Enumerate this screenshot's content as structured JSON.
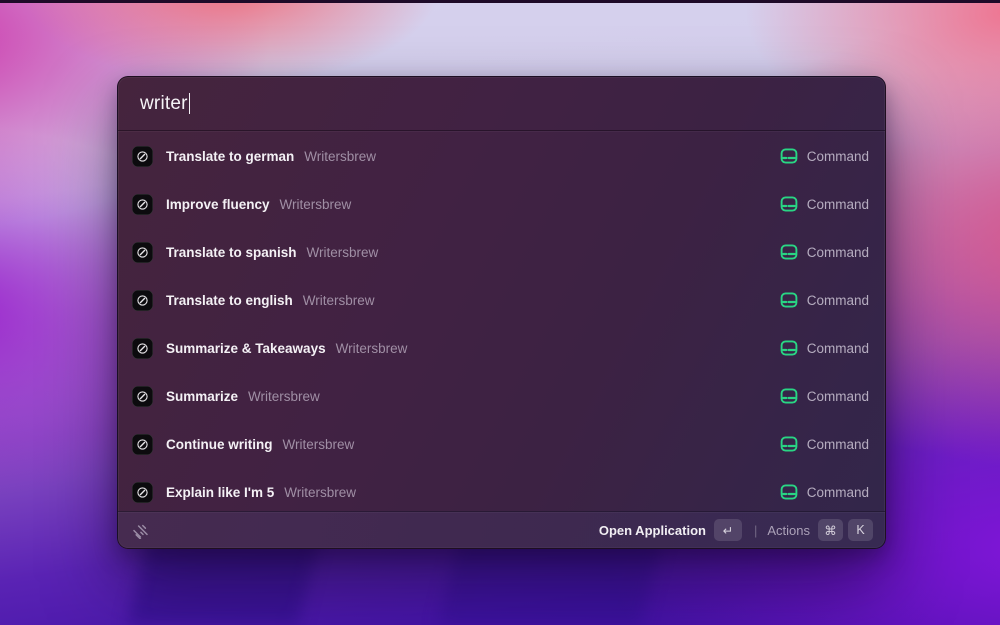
{
  "search": {
    "query": "writer"
  },
  "results": [
    {
      "title": "Translate to german",
      "app": "Writersbrew",
      "accessory": "Command"
    },
    {
      "title": "Improve fluency",
      "app": "Writersbrew",
      "accessory": "Command"
    },
    {
      "title": "Translate to spanish",
      "app": "Writersbrew",
      "accessory": "Command"
    },
    {
      "title": "Translate to english",
      "app": "Writersbrew",
      "accessory": "Command"
    },
    {
      "title": "Summarize & Takeaways",
      "app": "Writersbrew",
      "accessory": "Command"
    },
    {
      "title": "Summarize",
      "app": "Writersbrew",
      "accessory": "Command"
    },
    {
      "title": "Continue writing",
      "app": "Writersbrew",
      "accessory": "Command"
    },
    {
      "title": "Explain like I'm 5",
      "app": "Writersbrew",
      "accessory": "Command"
    }
  ],
  "footer": {
    "open_label": "Open Application",
    "return_key": "↵",
    "divider": "|",
    "actions_label": "Actions",
    "cmd_key": "⌘",
    "k_key": "K"
  },
  "icons": {
    "row_app_icon": "pencil-circle-icon",
    "accessory_icon": "command-terminal-icon",
    "footer_logo": "raycast-logo-icon"
  },
  "colors": {
    "accent_green": "#29d584",
    "window_bg": "#3e2240",
    "title_text": "#f4f1f5",
    "subtitle_text": "#a08fa5",
    "accessory_text": "#b6adc0"
  }
}
